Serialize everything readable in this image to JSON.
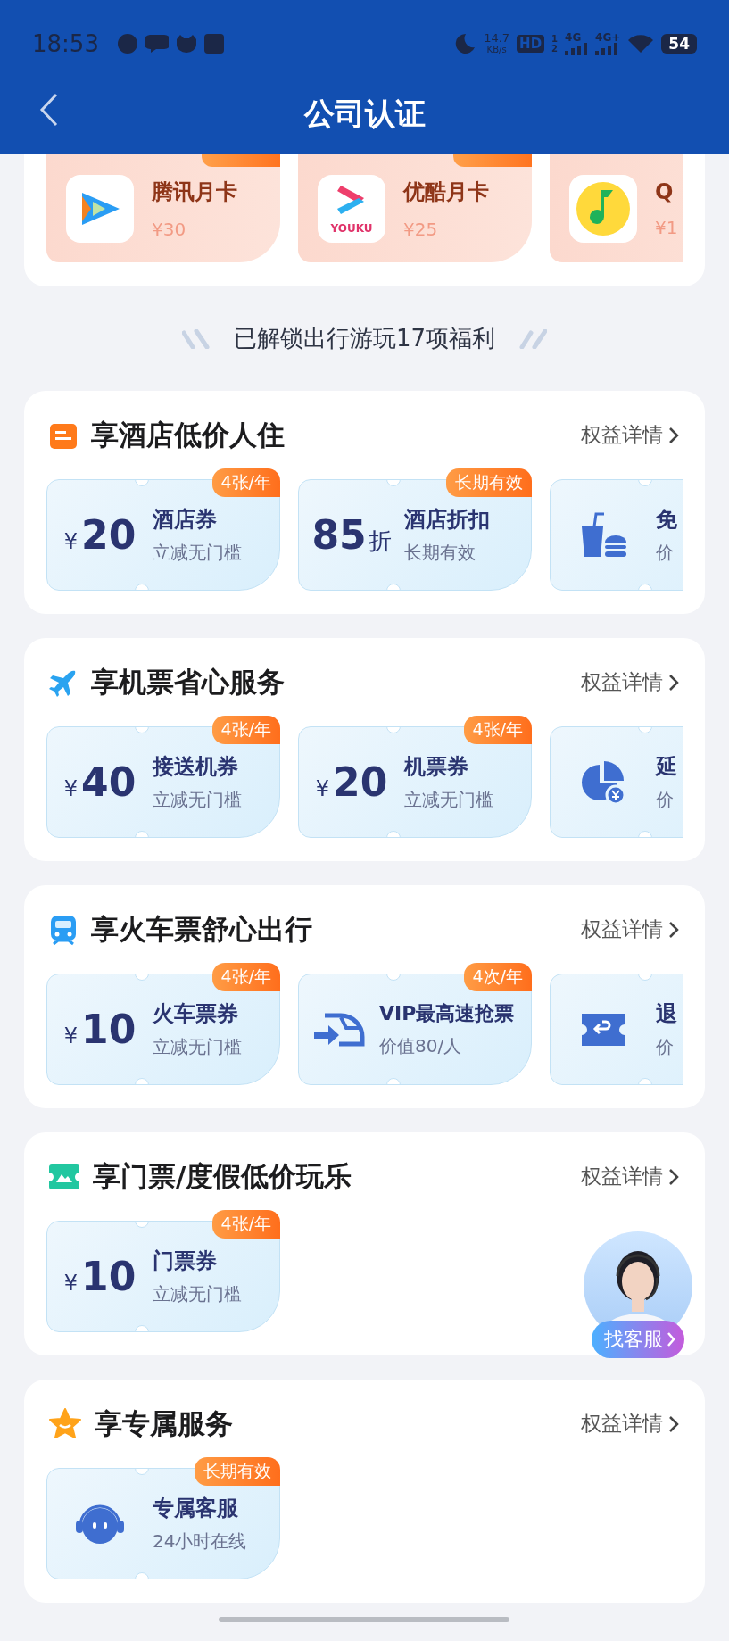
{
  "status_bar": {
    "time": "18:53",
    "speed": "14.7",
    "speed_unit": "KB/s",
    "hd": "HD",
    "hd_slots": [
      "1",
      "2"
    ],
    "networks": [
      "4G",
      "4G+"
    ],
    "battery": "54"
  },
  "header": {
    "title": "公司认证"
  },
  "top_coupons": [
    {
      "kind": "video",
      "name": "腾讯月卡",
      "price": "¥30",
      "badge": true
    },
    {
      "kind": "youku",
      "logo_text": "YOUKU",
      "name": "优酷月卡",
      "price": "¥25",
      "badge": true
    },
    {
      "kind": "music",
      "name": "Q",
      "price": "¥1"
    }
  ],
  "banner": "已解锁出行游玩17项福利",
  "sections": [
    {
      "kind": "hotel",
      "title": "享酒店低价人住",
      "link": "权益详情",
      "coupons": [
        {
          "kind": "amount",
          "currency": "¥",
          "amount": "20",
          "title": "酒店券",
          "subtitle": "立减无门槛",
          "badge": "4张/年"
        },
        {
          "kind": "discount",
          "amount": "85",
          "unit": "折",
          "title": "酒店折扣",
          "subtitle": "长期有效",
          "badge": "长期有效"
        },
        {
          "kind": "meal",
          "title": "免",
          "subtitle": "价"
        }
      ]
    },
    {
      "kind": "plane",
      "title": "享机票省心服务",
      "link": "权益详情",
      "coupons": [
        {
          "kind": "amount",
          "currency": "¥",
          "amount": "40",
          "title": "接送机券",
          "subtitle": "立减无门槛",
          "badge": "4张/年"
        },
        {
          "kind": "amount",
          "currency": "¥",
          "amount": "20",
          "title": "机票券",
          "subtitle": "立减无门槛",
          "badge": "4张/年"
        },
        {
          "kind": "delay",
          "title": "延",
          "subtitle": "价"
        }
      ]
    },
    {
      "kind": "train",
      "title": "享火车票舒心出行",
      "link": "权益详情",
      "coupons": [
        {
          "kind": "amount",
          "currency": "¥",
          "amount": "10",
          "title": "火车票券",
          "subtitle": "立减无门槛",
          "badge": "4张/年"
        },
        {
          "kind": "speed",
          "title": "VIP最高速抢票",
          "subtitle": "价值80/人",
          "badge": "4次/年"
        },
        {
          "kind": "refund",
          "title": "退",
          "subtitle": "价"
        }
      ]
    },
    {
      "kind": "ticket",
      "title": "享门票/度假低价玩乐",
      "link": "权益详情",
      "coupons": [
        {
          "kind": "amount",
          "currency": "¥",
          "amount": "10",
          "title": "门票券",
          "subtitle": "立减无门槛",
          "badge": "4张/年"
        }
      ]
    },
    {
      "kind": "star",
      "title": "享专属服务",
      "link": "权益详情",
      "coupons": [
        {
          "kind": "agent",
          "title": "专属客服",
          "subtitle": "24小时在线",
          "badge": "长期有效"
        }
      ]
    }
  ],
  "service_button": {
    "label": "找客服"
  }
}
